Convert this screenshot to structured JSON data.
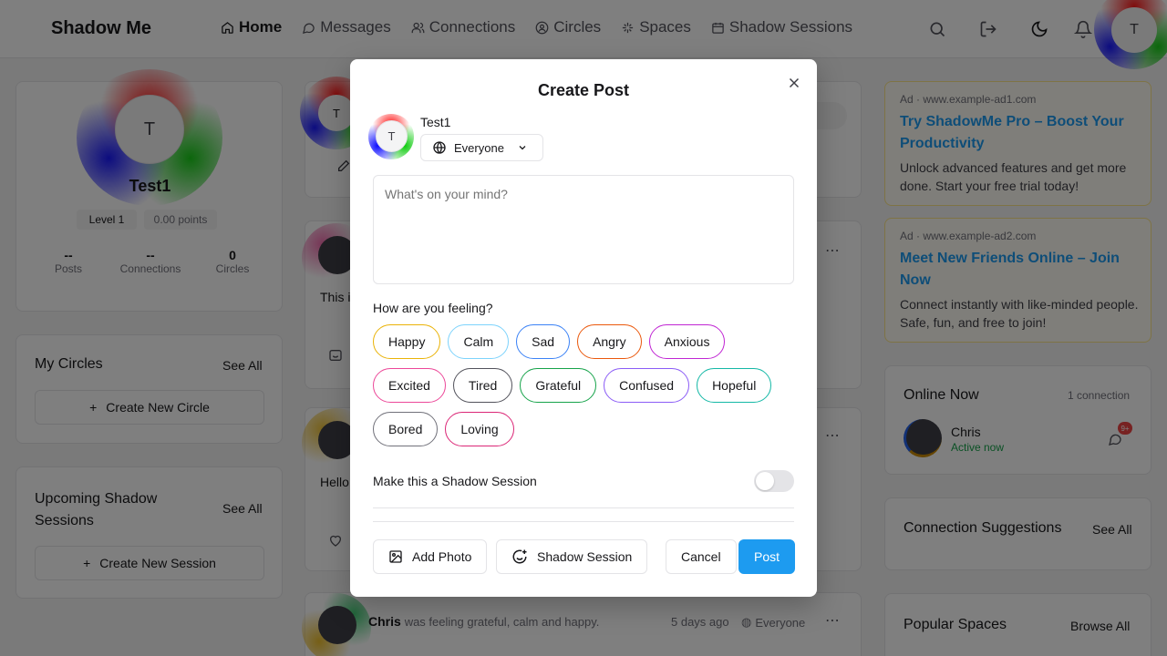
{
  "app": {
    "brand": "Shadow Me"
  },
  "nav": {
    "items": [
      {
        "label": "Home",
        "icon": "home-icon"
      },
      {
        "label": "Messages",
        "icon": "message-icon"
      },
      {
        "label": "Connections",
        "icon": "users-icon"
      },
      {
        "label": "Circles",
        "icon": "circle-user-icon"
      },
      {
        "label": "Spaces",
        "icon": "sparkle-icon"
      },
      {
        "label": "Shadow Sessions",
        "icon": "calendar-icon"
      }
    ],
    "avatar_initial": "T"
  },
  "profile": {
    "initial": "T",
    "name": "Test1",
    "level": "Level 1",
    "points": "0.00 points",
    "stats": [
      {
        "value": "--",
        "label": "Posts"
      },
      {
        "value": "--",
        "label": "Connections"
      },
      {
        "value": "0",
        "label": "Circles"
      }
    ]
  },
  "circles": {
    "title": "My Circles",
    "see_all": "See All",
    "create": "Create New Circle"
  },
  "sessions": {
    "title": "Upcoming Shadow Sessions",
    "see_all": "See All",
    "create": "Create New Session"
  },
  "feed": {
    "post1_text": "This i",
    "post2_text": "Hello",
    "post3": {
      "author": "Chris",
      "activity": "was feeling grateful, calm and happy.",
      "time": "5 days ago",
      "audience": "Everyone"
    }
  },
  "ads": [
    {
      "source": "Ad · www.example-ad1.com",
      "title": "Try ShadowMe Pro – Boost Your Productivity",
      "body": "Unlock advanced features and get more done. Start your free trial today!"
    },
    {
      "source": "Ad · www.example-ad2.com",
      "title": "Meet New Friends Online – Join Now",
      "body": "Connect instantly with like-minded people. Safe, fun, and free to join!"
    }
  ],
  "online": {
    "title": "Online Now",
    "count": "1 connection",
    "name": "Chris",
    "status": "Active now",
    "badge": "9+"
  },
  "suggestions": {
    "title": "Connection Suggestions",
    "see_all": "See All"
  },
  "spaces": {
    "title": "Popular Spaces",
    "browse": "Browse All"
  },
  "modal": {
    "title": "Create Post",
    "user": "Test1",
    "initial": "T",
    "audience": "Everyone",
    "placeholder": "What's on your mind?",
    "feeling_label": "How are you feeling?",
    "feelings": [
      {
        "label": "Happy",
        "color": "#eab308"
      },
      {
        "label": "Calm",
        "color": "#7dd3fc"
      },
      {
        "label": "Sad",
        "color": "#3b82f6"
      },
      {
        "label": "Angry",
        "color": "#ea580c"
      },
      {
        "label": "Anxious",
        "color": "#c026d3"
      },
      {
        "label": "Excited",
        "color": "#ec4899"
      },
      {
        "label": "Tired",
        "color": "#52525b"
      },
      {
        "label": "Grateful",
        "color": "#16a34a"
      },
      {
        "label": "Confused",
        "color": "#8b5cf6"
      },
      {
        "label": "Hopeful",
        "color": "#14b8a6"
      },
      {
        "label": "Bored",
        "color": "#71717a"
      },
      {
        "label": "Loving",
        "color": "#db2777"
      }
    ],
    "shadow_label": "Make this a Shadow Session",
    "add_photo": "Add Photo",
    "shadow_session": "Shadow Session",
    "cancel": "Cancel",
    "post": "Post",
    "accent": "#1d9bf0"
  }
}
